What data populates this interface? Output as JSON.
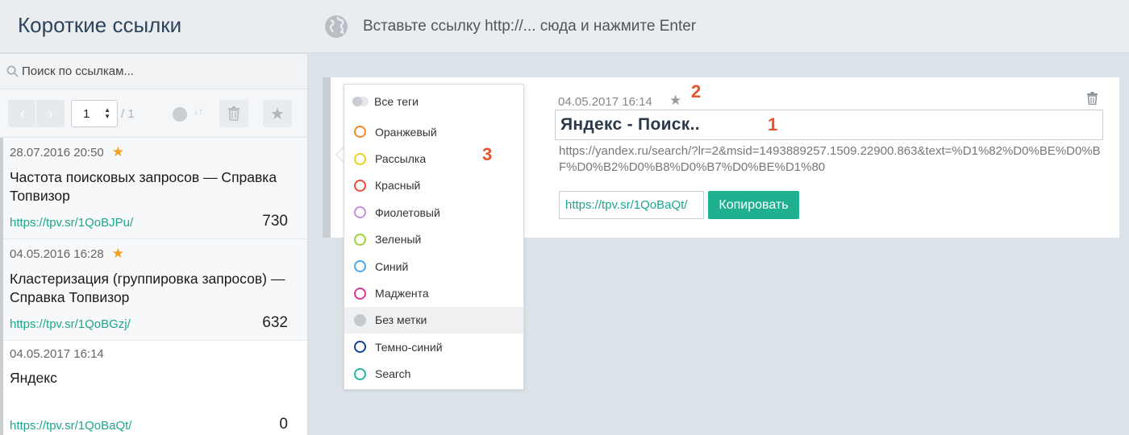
{
  "header": {
    "title": "Короткие ссылки",
    "url_placeholder": "Вставьте ссылку http://... сюда и нажмите Enter"
  },
  "sidebar": {
    "search_placeholder": "Поиск по ссылкам...",
    "pager": {
      "prev": "‹",
      "next": "›",
      "page": "1",
      "total": "/ 1"
    },
    "items": [
      {
        "date": "28.07.2016 20:50",
        "starred": true,
        "title": "Частота поисковых запросов — Справка Топвизор",
        "link": "https://tpv.sr/1QoBJPu/",
        "count": "730"
      },
      {
        "date": "04.05.2016 16:28",
        "starred": true,
        "title": "Кластеризация (группировка запросов) — Справка Топвизор",
        "link": "https://tpv.sr/1QoBGzj/",
        "count": "632"
      },
      {
        "date": "04.05.2017 16:14",
        "starred": false,
        "title": "Яндекс",
        "link": "https://tpv.sr/1QoBaQt/",
        "count": "0"
      }
    ]
  },
  "card": {
    "date": "04.05.2017 16:14",
    "title": "Яндекс - Поиск..",
    "long_url": "https://yandex.ru/search/?lr=2&msid=1493889257.1509.22900.863&text=%D1%82%D0%BE%D0%BF%D0%B2%D0%B8%D0%B7%D0%BE%D1%80",
    "short_url": "https://tpv.sr/1QoBaQt/",
    "copy_label": "Копировать"
  },
  "markers": {
    "m1": "1",
    "m2": "2",
    "m3": "3"
  },
  "tags": {
    "all_label": "Все теги",
    "items": [
      {
        "label": "Оранжевый",
        "color": "#f08a24"
      },
      {
        "label": "Рассылка",
        "color": "#e8d21c"
      },
      {
        "label": "Красный",
        "color": "#f04a3a"
      },
      {
        "label": "Фиолетовый",
        "color": "#c58fdc"
      },
      {
        "label": "Зеленый",
        "color": "#9bd23a"
      },
      {
        "label": "Синий",
        "color": "#4aa6ef"
      },
      {
        "label": "Маджента",
        "color": "#e0358f"
      },
      {
        "label": "Без метки",
        "color": "#c4c9ce"
      },
      {
        "label": "Темно-синий",
        "color": "#123f9a"
      },
      {
        "label": "Search",
        "color": "#20b6a0"
      }
    ]
  }
}
